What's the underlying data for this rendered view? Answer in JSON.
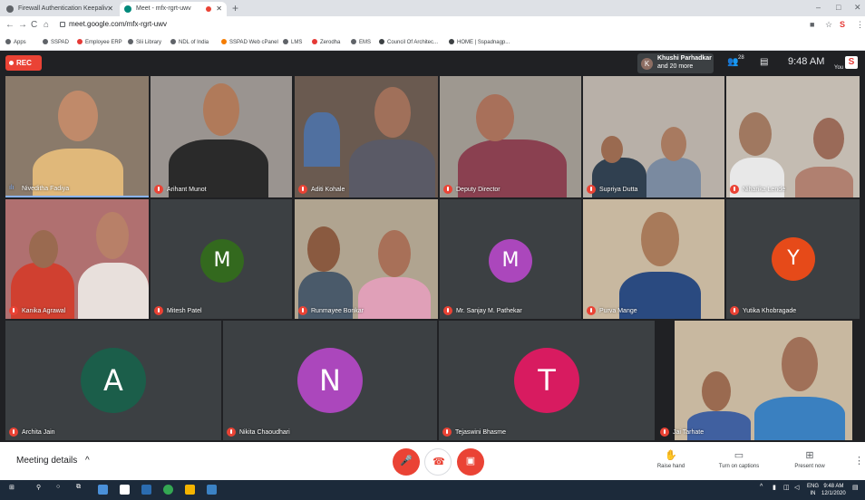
{
  "browser": {
    "tabs": [
      {
        "label": "Firewall Authentication Keepaliv",
        "active": false
      },
      {
        "label": "Meet - mfx-rgrt-uwv",
        "active": true
      }
    ],
    "new_tab": "+",
    "window_controls": [
      "–",
      "□",
      "✕"
    ],
    "url": "meet.google.com/mfx-rgrt-uwv",
    "bookmarks": [
      "Apps",
      "SSPAD",
      "Employee ERP",
      "Slii Library",
      "NDL of India",
      "SSPAD Web cPanel",
      "LMS",
      "Zerodha",
      "EMS",
      "Council Of Architec...",
      "HOME | Sspadnagp..."
    ]
  },
  "meet": {
    "rec_label": "REC",
    "presenter": {
      "initial": "K",
      "name": "Khushi Parhadkar",
      "more": "and 20 more"
    },
    "people_count": "28",
    "time": "9:48 AM",
    "you_label": "You",
    "you_logo": "S"
  },
  "participants": [
    {
      "name": "Niveditha Fadiya",
      "muted": false,
      "speaking": true
    },
    {
      "name": "Arihant Munot",
      "muted": true
    },
    {
      "name": "Aditi Kohale",
      "muted": true
    },
    {
      "name": "Deputy Director",
      "muted": true
    },
    {
      "name": "Supriya Dutta",
      "muted": true
    },
    {
      "name": "Niharika Lende",
      "muted": true
    },
    {
      "name": "Kanika Agrawal",
      "muted": true
    },
    {
      "name": "Mitesh Patel",
      "muted": true,
      "initial": "M",
      "color": "#33691e"
    },
    {
      "name": "Runmayee Bonkar",
      "muted": true
    },
    {
      "name": "Mr. Sanjay M. Pathekar",
      "muted": true,
      "initial": "M",
      "color": "#ab47bc"
    },
    {
      "name": "Purva Mange",
      "muted": true
    },
    {
      "name": "Yutika Khobragade",
      "muted": true,
      "initial": "Y",
      "color": "#e64a19"
    },
    {
      "name": "Archita Jain",
      "muted": true,
      "initial": "A",
      "color": "#1b5e4a"
    },
    {
      "name": "Nikita Chaoudhari",
      "muted": true,
      "initial": "N",
      "color": "#ab47bc"
    },
    {
      "name": "Tejaswini Bhasme",
      "muted": true,
      "initial": "T",
      "color": "#d81b60"
    },
    {
      "name": "Jai Tarhate",
      "muted": true
    }
  ],
  "bottom": {
    "meeting_details": "Meeting details",
    "raise_hand": "Raise hand",
    "captions": "Turn on captions",
    "present": "Present now"
  },
  "taskbar": {
    "lang": "ENG",
    "region": "IN",
    "time": "9:48 AM",
    "date": "12/1/2020"
  }
}
